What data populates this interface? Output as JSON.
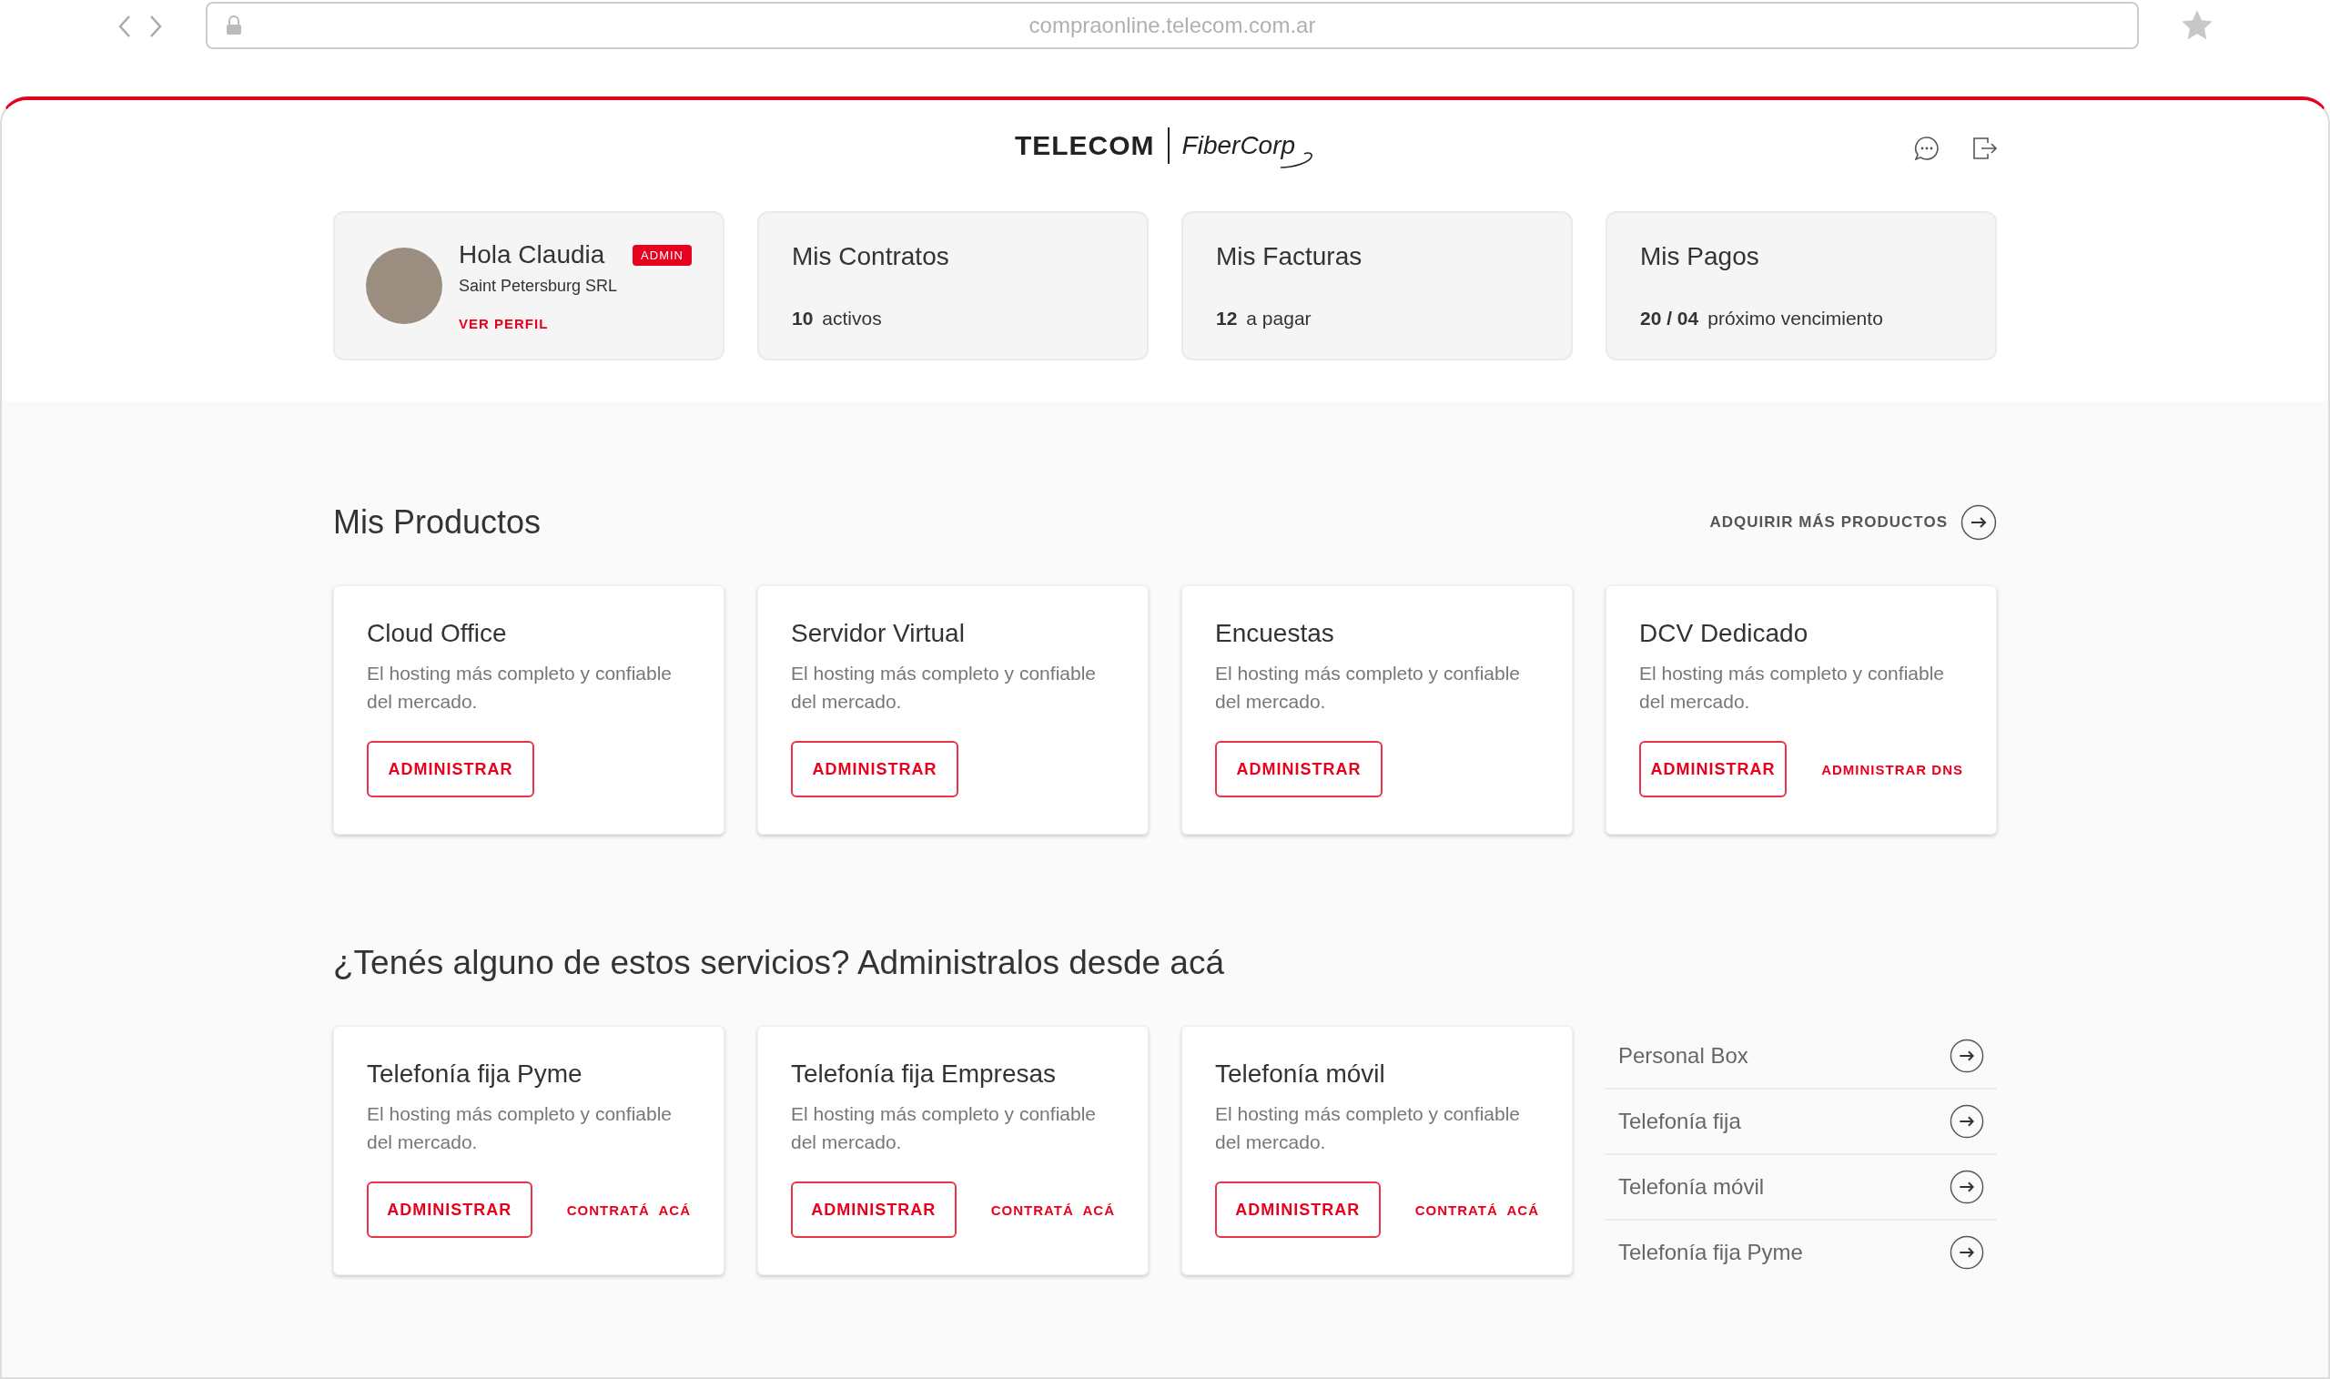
{
  "browser": {
    "url": "compraonline.telecom.com.ar"
  },
  "header": {
    "logo_primary": "TELECOM",
    "logo_secondary": "FiberCorp"
  },
  "profile": {
    "greeting": "Hola Claudia",
    "badge": "ADMIN",
    "company": "Saint Petersburg SRL",
    "link": "VER PERFIL"
  },
  "summary": [
    {
      "title": "Mis Contratos",
      "count": "10",
      "label": "activos"
    },
    {
      "title": "Mis Facturas",
      "count": "12",
      "label": "a pagar"
    },
    {
      "title": "Mis Pagos",
      "count": "20 / 04",
      "label": "próximo vencimiento"
    }
  ],
  "products": {
    "title": "Mis Productos",
    "action": "ADQUIRIR MÁS PRODUCTOS",
    "items": [
      {
        "title": "Cloud Office",
        "description": "El hosting más completo y confiable del mercado.",
        "button": "ADMINISTRAR"
      },
      {
        "title": "Servidor Virtual",
        "description": "El hosting más completo y confiable del mercado.",
        "button": "ADMINISTRAR"
      },
      {
        "title": "Encuestas",
        "description": "El hosting más completo y confiable del mercado.",
        "button": "ADMINISTRAR"
      },
      {
        "title": "DCV Dedicado",
        "description": "El hosting más completo y confiable del mercado.",
        "button": "ADMINISTRAR",
        "link": "ADMINISTRAR DNS"
      }
    ]
  },
  "services": {
    "title": "¿Tenés alguno de estos servicios? Administralos desde acá",
    "items": [
      {
        "title": "Telefonía fija Pyme",
        "description": "El hosting más completo y confiable del mercado.",
        "button": "ADMINISTRAR",
        "link": "CONTRATÁ  ACÁ"
      },
      {
        "title": "Telefonía fija Empresas",
        "description": "El hosting más completo y confiable del mercado.",
        "button": "ADMINISTRAR",
        "link": "CONTRATÁ  ACÁ"
      },
      {
        "title": "Telefonía móvil",
        "description": "El hosting más completo y confiable del mercado.",
        "button": "ADMINISTRAR",
        "link": "CONTRATÁ  ACÁ"
      }
    ],
    "links": [
      {
        "label": "Personal Box"
      },
      {
        "label": "Telefonía fija"
      },
      {
        "label": "Telefonía móvil"
      },
      {
        "label": "Telefonía fija Pyme"
      }
    ]
  }
}
